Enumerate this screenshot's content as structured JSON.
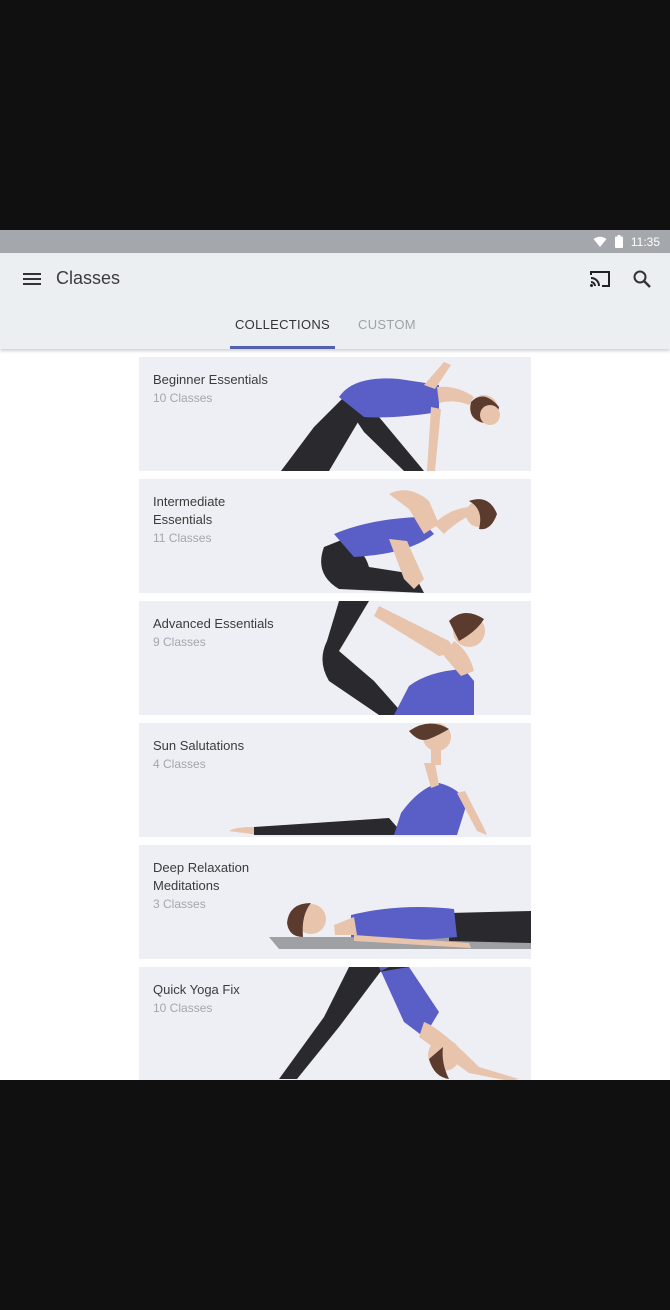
{
  "status_bar": {
    "time": "11:35",
    "wifi_icon": "wifi-icon",
    "battery_icon": "battery-icon"
  },
  "app_bar": {
    "menu_icon": "hamburger-menu-icon",
    "title": "Classes",
    "cast_icon": "cast-icon",
    "search_icon": "search-icon"
  },
  "tabs": [
    {
      "label": "COLLECTIONS",
      "selected": true
    },
    {
      "label": "CUSTOM",
      "selected": false
    }
  ],
  "collections": [
    {
      "title": "Beginner Essentials",
      "count": "10 Classes",
      "image": "triangle-pose-photo"
    },
    {
      "title": "Intermediate Essentials",
      "count": "11 Classes",
      "image": "twist-pose-photo"
    },
    {
      "title": "Advanced Essentials",
      "count": "9 Classes",
      "image": "bow-pose-photo"
    },
    {
      "title": "Sun Salutations",
      "count": "4 Classes",
      "image": "upward-dog-pose-photo"
    },
    {
      "title": "Deep Relaxation Meditations",
      "count": "3 Classes",
      "image": "corpse-pose-photo"
    },
    {
      "title": "Quick Yoga Fix",
      "count": "10 Classes",
      "image": "downward-dog-pose-photo"
    }
  ],
  "colors": {
    "accent": "#5361b0",
    "top_bar": "#eceff2",
    "status_bar": "#a4a7ab",
    "card_bg": "#eeeff4",
    "tank_top": "#5a5fc8",
    "pants": "#2a2a2e",
    "skin": "#e8c4ad"
  }
}
